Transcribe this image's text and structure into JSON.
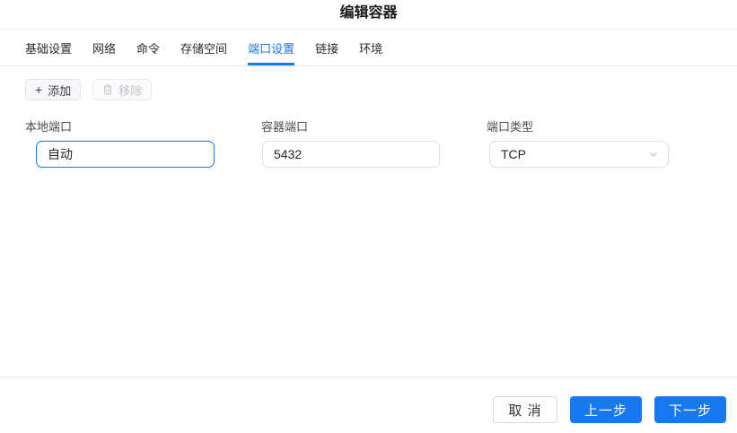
{
  "dialog": {
    "title": "编辑容器"
  },
  "tabs": [
    {
      "label": "基础设置",
      "active": false
    },
    {
      "label": "网络",
      "active": false
    },
    {
      "label": "命令",
      "active": false
    },
    {
      "label": "存储空间",
      "active": false
    },
    {
      "label": "端口设置",
      "active": true
    },
    {
      "label": "链接",
      "active": false
    },
    {
      "label": "环境",
      "active": false
    }
  ],
  "toolbar": {
    "add": {
      "label": "添加",
      "icon": "plus-icon",
      "disabled": false
    },
    "remove": {
      "label": "移除",
      "icon": "trash-icon",
      "disabled": true
    }
  },
  "form": {
    "fields": [
      {
        "label": "本地端口",
        "value": "自动",
        "control": "input",
        "state": "focused"
      },
      {
        "label": "容器端口",
        "value": "5432",
        "control": "input",
        "state": "normal"
      },
      {
        "label": "端口类型",
        "value": "TCP",
        "control": "select",
        "icon": "chevron-down-icon"
      }
    ]
  },
  "footer": {
    "cancel_label": "取 消",
    "prev_label": "上一步",
    "next_label": "下一步"
  },
  "colors": {
    "accent": "#1778f2",
    "primary_button_bg": "#1778f2",
    "active_tab": "#1778f2",
    "divider": "#e6e6e6",
    "input_border": "#dcdfe6",
    "disabled_text": "#bfc3cc"
  }
}
